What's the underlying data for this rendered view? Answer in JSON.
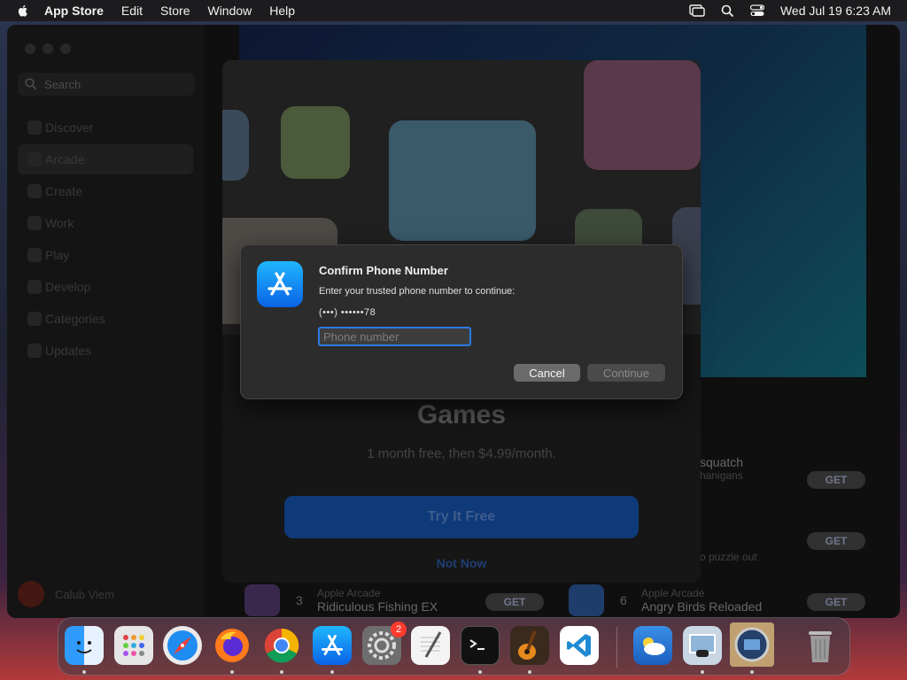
{
  "menubar": {
    "app_name": "App Store",
    "items": [
      "Edit",
      "Store",
      "Window",
      "Help"
    ],
    "datetime": "Wed Jul 19  6:23 AM"
  },
  "sidebar": {
    "search_placeholder": "Search",
    "items": [
      {
        "label": "Discover"
      },
      {
        "label": "Arcade"
      },
      {
        "label": "Create"
      },
      {
        "label": "Work"
      },
      {
        "label": "Play"
      },
      {
        "label": "Develop"
      },
      {
        "label": "Categories"
      },
      {
        "label": "Updates"
      }
    ],
    "user_name": "Calub Viem"
  },
  "sheet": {
    "title": "Games",
    "subtitle": "1 month free, then $4.99/month.",
    "try_label": "Try It Free",
    "not_now_label": "Not Now"
  },
  "list": {
    "rows": [
      {
        "num": "",
        "category": "",
        "name": "squatch",
        "subtitle": "hanigans",
        "get": "GET"
      },
      {
        "num": "",
        "category": "",
        "name": "",
        "subtitle": "o puzzle out",
        "get": "GET"
      },
      {
        "num": "3",
        "category": "Apple Arcade",
        "name": "Ridiculous Fishing EX",
        "get": "GET"
      },
      {
        "num": "6",
        "category": "Apple Arcade",
        "name": "Angry Birds Reloaded",
        "get": "GET"
      }
    ]
  },
  "dialog": {
    "title": "Confirm Phone Number",
    "message": "Enter your trusted phone number to continue:",
    "masked_number": "(•••) ••••••78",
    "input_placeholder": "Phone number",
    "cancel_label": "Cancel",
    "continue_label": "Continue"
  },
  "dock": {
    "badge_count": "2",
    "apps": [
      "finder-icon",
      "launchpad-icon",
      "safari-icon",
      "firefox-icon",
      "chrome-icon",
      "app-store-icon",
      "system-settings-icon",
      "textedit-icon",
      "terminal-icon",
      "garageband-icon",
      "vscode-icon",
      "weather-icon",
      "preview-icon",
      "network-icon",
      "trash-icon"
    ]
  }
}
